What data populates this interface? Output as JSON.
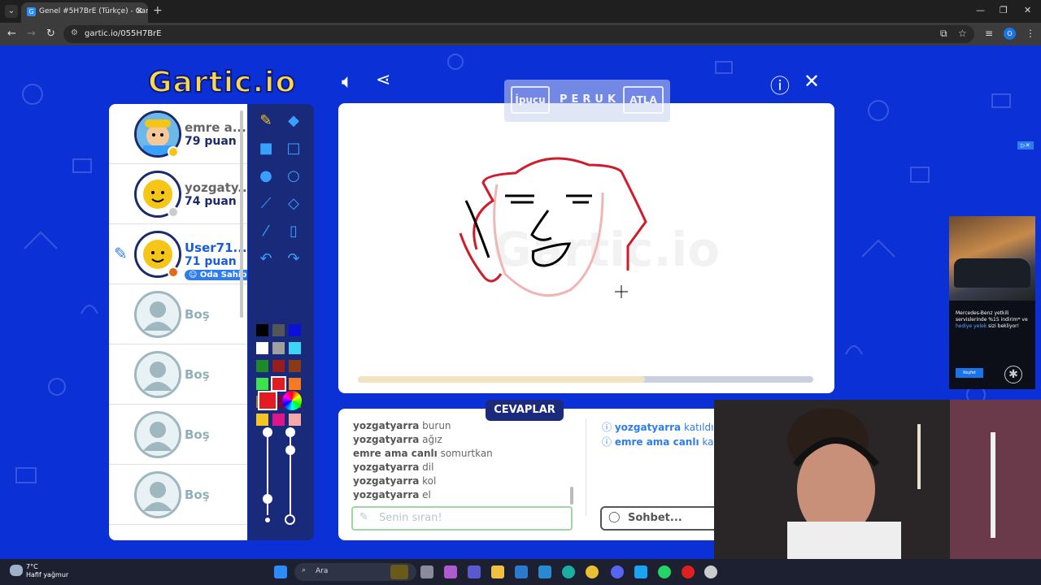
{
  "browser": {
    "tab_title": "Genel #5H7BrE (Türkçe) - Gartic",
    "url": "gartic.io/055H7BrE",
    "profile_initial": "O"
  },
  "game": {
    "logo": "Gartic.io",
    "players": [
      {
        "name": "emre a...",
        "points": "79 puan",
        "status_color": "#f5c518"
      },
      {
        "name": "yozgaty...",
        "points": "74 puan",
        "status_color": "#cccccc"
      },
      {
        "name": "User71...",
        "points": "71 puan",
        "status_color": "#e06a1a",
        "badge": "Oda Sahibi"
      },
      {
        "empty": "Boş"
      },
      {
        "empty": "Boş"
      },
      {
        "empty": "Boş"
      },
      {
        "empty": "Boş"
      }
    ],
    "palette": [
      "#000000",
      "#555555",
      "#0b10d8",
      "#ffffff",
      "#a0a0a0",
      "#3fd6f5",
      "#1f8a2a",
      "#9a1d1d",
      "#8a3a14",
      "#3de34b",
      "#e41b23",
      "#f57a20",
      "#b07a20",
      "#800040",
      "#8a6a60",
      "#f4c520",
      "#e0158a",
      "#f5a8a8"
    ],
    "selected_color": "#e41b23",
    "hint": {
      "hint_label": "İpucu",
      "word": "PERUK",
      "skip_label": "ATLA"
    },
    "timer_progress": 0.63,
    "answers_title": "CEVAPLAR",
    "answers": [
      {
        "user": "yozgatyarra",
        "text": "burun"
      },
      {
        "user": "yozgatyarra",
        "text": "ağız"
      },
      {
        "user": "emre ama canlı",
        "text": "somurtkan"
      },
      {
        "user": "yozgatyarra",
        "text": "dil"
      },
      {
        "user": "yozgatyarra",
        "text": "kol"
      },
      {
        "user": "yozgatyarra",
        "text": "el"
      }
    ],
    "chat": [
      {
        "user": "yozgatyarra",
        "text": "katıldı"
      },
      {
        "user": "emre ama canlı",
        "text": "katıldı"
      }
    ],
    "answer_placeholder": "Senin sıran!",
    "chat_placeholder": "Sohbet..."
  },
  "ad": {
    "text1": "Mercedes-Benz yetkili servislerinde %15 indirim* ve",
    "text2": "hediye yelek",
    "text3": "sizi bekliyor!",
    "button": "Keşfet"
  },
  "taskbar": {
    "temp": "7°C",
    "weather": "Hafif yağmur",
    "search": "Ara"
  }
}
